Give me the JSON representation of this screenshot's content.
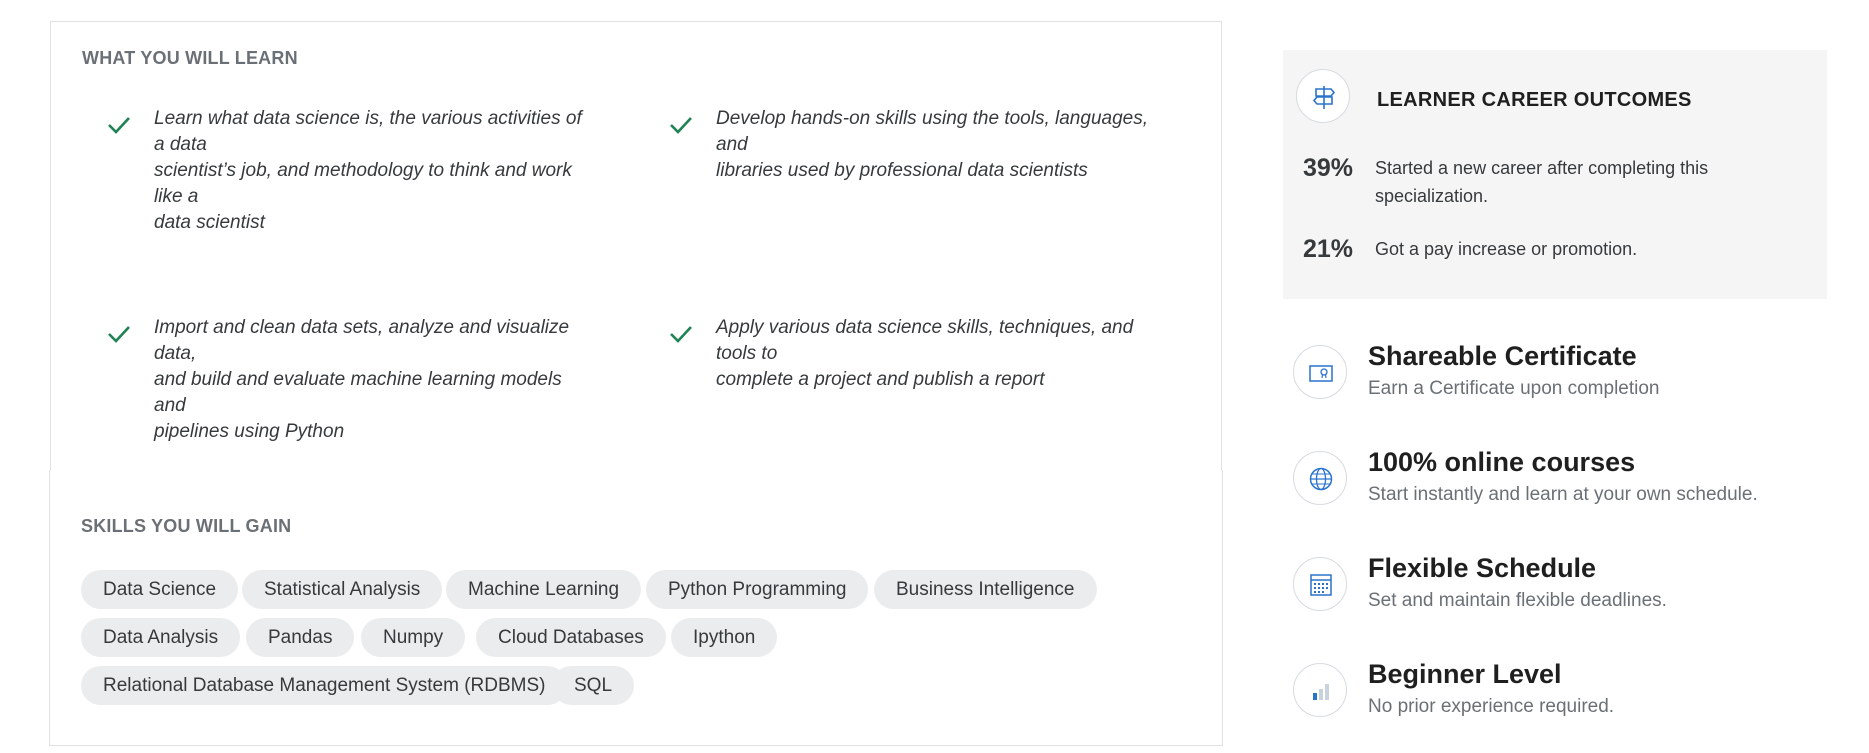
{
  "learn": {
    "title": "WHAT YOU WILL LEARN",
    "items": [
      {
        "line1": "Learn what data science is, the various activities of a data",
        "line2": "scientist’s job, and methodology to think and work like a",
        "line3": "data scientist"
      },
      {
        "line1": "Develop hands-on skills using the tools, languages, and",
        "line2": "libraries used by professional data scientists",
        "line3": ""
      },
      {
        "line1": "Import and clean data sets, analyze and visualize data,",
        "line2": "and build and evaluate machine learning models and",
        "line3": "pipelines using Python"
      },
      {
        "line1": "Apply various data science skills, techniques, and tools to",
        "line2": "complete a project and publish a report",
        "line3": ""
      }
    ]
  },
  "skills": {
    "title": "SKILLS YOU WILL GAIN",
    "tags": [
      "Data Science",
      "Statistical Analysis",
      "Machine Learning",
      "Python Programming",
      "Business Intelligence",
      "Data Analysis",
      "Pandas",
      "Numpy",
      "Cloud Databases",
      "Ipython",
      "Relational Database Management System (RDBMS)",
      "SQL"
    ]
  },
  "outcomes": {
    "title": "LEARNER CAREER OUTCOMES",
    "icon": "signpost-icon",
    "stats": [
      {
        "value": "39%",
        "line1": "Started a new career after completing this",
        "line2": "specialization."
      },
      {
        "value": "21%",
        "line1": "Got a pay increase or promotion.",
        "line2": ""
      }
    ]
  },
  "features": [
    {
      "icon": "certificate-icon",
      "title": "Shareable Certificate",
      "subtitle": "Earn a Certificate upon completion"
    },
    {
      "icon": "globe-icon",
      "title": "100% online courses",
      "subtitle": "Start instantly and learn at your own schedule."
    },
    {
      "icon": "calendar-icon",
      "title": "Flexible Schedule",
      "subtitle": "Set and maintain flexible deadlines."
    },
    {
      "icon": "level-bars-icon",
      "title": "Beginner Level",
      "subtitle": "No prior experience required."
    }
  ],
  "colors": {
    "check": "#1f8354",
    "icon_blue": "#2a73cc",
    "tag_bg": "#ebeced",
    "outcomes_bg": "#f5f5f5"
  }
}
